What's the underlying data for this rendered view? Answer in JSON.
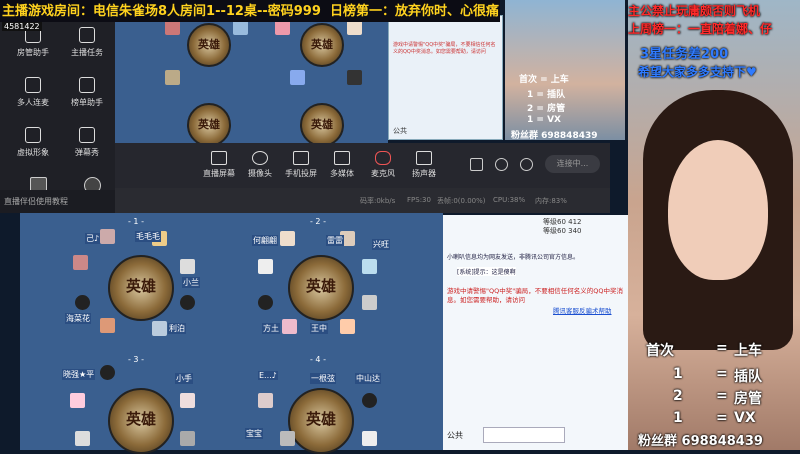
{
  "banner": {
    "line1": "主播游戏房间：电信朱雀场8人房间1--12桌--密码999",
    "line2": "日榜第一：放弃你时、心很痛"
  },
  "room_id": "4581422",
  "panel": {
    "items": [
      {
        "label": "房管助手",
        "icon": "people-icon"
      },
      {
        "label": "主播任务",
        "icon": "task-icon"
      },
      {
        "label": "多人连麦",
        "icon": "mic-link-icon"
      },
      {
        "label": "榜单助手",
        "icon": "rank-icon"
      },
      {
        "label": "虚拟形象",
        "icon": "avatar-icon"
      },
      {
        "label": "弹幕秀",
        "icon": "danmaku-icon"
      }
    ],
    "tutorial": "直播伴侣使用教程"
  },
  "toolbar": {
    "buttons": [
      {
        "label": "直播屏幕",
        "icon": "screen-icon"
      },
      {
        "label": "摄像头",
        "icon": "camera-icon"
      },
      {
        "label": "手机投屏",
        "icon": "phone-icon"
      },
      {
        "label": "多媒体",
        "icon": "media-icon"
      },
      {
        "label": "麦克风",
        "icon": "mic-icon"
      },
      {
        "label": "扬声器",
        "icon": "speaker-icon"
      }
    ],
    "start_label": "连接中...",
    "stats": [
      "码率:0kb/s",
      "FPS:30",
      "丢帧:0(0.00%)",
      "CPU:38%",
      "内存:83%"
    ]
  },
  "game": {
    "table_logo": "英雄",
    "tables_bottom": [
      "- 1 -",
      "- 2 -",
      "- 3 -",
      "- 4 -"
    ],
    "names_bottom": [
      "己♪",
      "毛毛毛",
      "何翩翩",
      "雷雷",
      "兴旺",
      "小兰",
      "海菜花",
      "利泊",
      "方土",
      "王中",
      "晓强★平",
      "小手",
      "E...♪",
      "一根弦",
      "中山达",
      "宝宝"
    ]
  },
  "chat": {
    "notice1": "小喇叭信息均为网友发送，非腾讯公司官方信息。",
    "notice2": "[系统]提示：这是傻啊",
    "warning": "游戏中请警惕\"QQ中奖\"骗局，不要相信任何名义的QQ中奖消息。如您需要帮助，请访问",
    "link": "腾讯客服反骗术帮助",
    "channel": "公共",
    "level_rows": [
      "等级60  412",
      "等级60  340"
    ]
  },
  "overlay": {
    "line1": "主公禁止玩庸颇否则飞机",
    "line2": "上周榜一：一直陪着娜、仔",
    "line3": "3星任务差200",
    "line4": "希望大家多多支持下♥",
    "prizes": [
      {
        "rank": "首次",
        "arrow": "=",
        "reward": "上车"
      },
      {
        "rank": "1",
        "arrow": "=",
        "reward": "插队"
      },
      {
        "rank": "2",
        "arrow": "=",
        "reward": "房管"
      },
      {
        "rank": "1",
        "arrow": "=",
        "reward": "VX"
      }
    ],
    "fans": "粉丝群 698848439"
  },
  "small_overlay": {
    "prizes": [
      "首次 = 上车",
      "1 = 插队",
      "2 = 房管",
      "1 = VX"
    ],
    "fans": "粉丝群 698848439"
  },
  "colors": {
    "banner_text": "#ffd21e",
    "overlay_red": "#ff2a2a",
    "overlay_blue": "#2f7bff",
    "prize_white": "#ffffff"
  }
}
